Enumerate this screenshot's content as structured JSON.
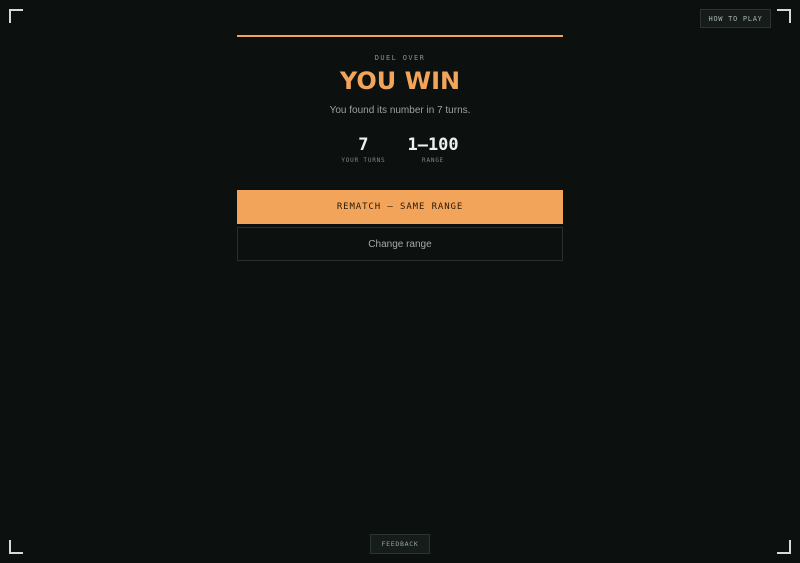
{
  "header": {
    "how_to_play_label": "HOW TO PLAY"
  },
  "result": {
    "eyebrow": "DUEL OVER",
    "title": "YOU WIN",
    "subtitle": "You found its number in 7 turns."
  },
  "stats": [
    {
      "value": "7",
      "label": "YOUR TURNS"
    },
    {
      "value": "1–100",
      "label": "RANGE"
    }
  ],
  "actions": {
    "rematch_label": "REMATCH — SAME RANGE",
    "change_range_label": "Change range"
  },
  "footer": {
    "feedback_label": "FEEDBACK"
  },
  "colors": {
    "background": "#0c100f",
    "accent": "#f2a45a"
  }
}
